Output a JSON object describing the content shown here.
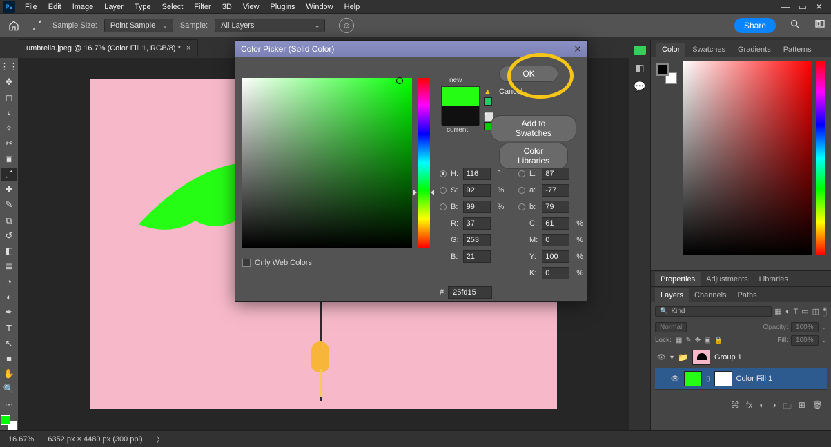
{
  "menubar": [
    "File",
    "Edit",
    "Image",
    "Layer",
    "Type",
    "Select",
    "Filter",
    "3D",
    "View",
    "Plugins",
    "Window",
    "Help"
  ],
  "app_icon_text": "Ps",
  "options": {
    "sample_size_label": "Sample Size:",
    "sample_size_value": "Point Sample",
    "sample_label": "Sample:",
    "sample_value": "All Layers",
    "share": "Share"
  },
  "tab": {
    "title": "umbrella.jpeg @ 16.7% (Color Fill 1, RGB/8) *"
  },
  "picker": {
    "title": "Color Picker (Solid Color)",
    "ok": "OK",
    "cancel": "Cancel",
    "add": "Add to Swatches",
    "libs": "Color Libraries",
    "new": "new",
    "current": "current",
    "only_web": "Only Web Colors",
    "hex": "25fd15",
    "fields": {
      "H": "116",
      "S": "92",
      "B": "99",
      "R": "37",
      "G": "253",
      "Bb": "21",
      "L": "87",
      "a": "-77",
      "b": "79",
      "C": "61",
      "M": "0",
      "Y": "100",
      "K": "0"
    },
    "units": {
      "deg": "°",
      "pct": "%"
    },
    "labels": {
      "H": "H:",
      "S": "S:",
      "B": "B:",
      "R": "R:",
      "G": "G:",
      "Bb": "B:",
      "L": "L:",
      "a": "a:",
      "b": "b:",
      "C": "C:",
      "M": "M:",
      "Y": "Y:",
      "K": "K:",
      "hash": "#"
    }
  },
  "color_panel": {
    "tabs": [
      "Color",
      "Swatches",
      "Gradients",
      "Patterns"
    ]
  },
  "mid_panel": {
    "tabs": [
      "Properties",
      "Adjustments",
      "Libraries"
    ]
  },
  "layers_panel": {
    "tabs": [
      "Layers",
      "Channels",
      "Paths"
    ],
    "filter_kind": "Kind",
    "blend": "Normal",
    "opacity_label": "Opacity:",
    "opacity_val": "100%",
    "lock_label": "Lock:",
    "fill_label": "Fill:",
    "fill_val": "100%",
    "group_name": "Group 1",
    "fill_layer_name": "Color Fill 1",
    "fx_label": "fx"
  },
  "status": {
    "zoom": "16.67%",
    "dims": "6352 px × 4480 px (300 ppi)"
  }
}
